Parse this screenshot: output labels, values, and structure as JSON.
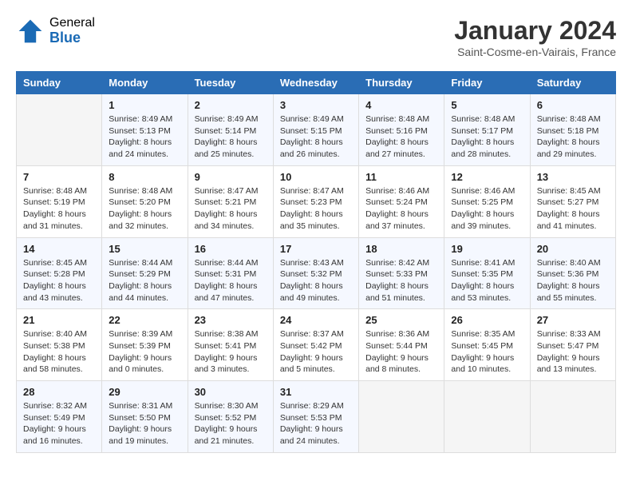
{
  "logo": {
    "general": "General",
    "blue": "Blue"
  },
  "title": "January 2024",
  "location": "Saint-Cosme-en-Vairais, France",
  "weekdays": [
    "Sunday",
    "Monday",
    "Tuesday",
    "Wednesday",
    "Thursday",
    "Friday",
    "Saturday"
  ],
  "weeks": [
    [
      {
        "day": "",
        "text": ""
      },
      {
        "day": "1",
        "text": "Sunrise: 8:49 AM\nSunset: 5:13 PM\nDaylight: 8 hours\nand 24 minutes."
      },
      {
        "day": "2",
        "text": "Sunrise: 8:49 AM\nSunset: 5:14 PM\nDaylight: 8 hours\nand 25 minutes."
      },
      {
        "day": "3",
        "text": "Sunrise: 8:49 AM\nSunset: 5:15 PM\nDaylight: 8 hours\nand 26 minutes."
      },
      {
        "day": "4",
        "text": "Sunrise: 8:48 AM\nSunset: 5:16 PM\nDaylight: 8 hours\nand 27 minutes."
      },
      {
        "day": "5",
        "text": "Sunrise: 8:48 AM\nSunset: 5:17 PM\nDaylight: 8 hours\nand 28 minutes."
      },
      {
        "day": "6",
        "text": "Sunrise: 8:48 AM\nSunset: 5:18 PM\nDaylight: 8 hours\nand 29 minutes."
      }
    ],
    [
      {
        "day": "7",
        "text": "Sunrise: 8:48 AM\nSunset: 5:19 PM\nDaylight: 8 hours\nand 31 minutes."
      },
      {
        "day": "8",
        "text": "Sunrise: 8:48 AM\nSunset: 5:20 PM\nDaylight: 8 hours\nand 32 minutes."
      },
      {
        "day": "9",
        "text": "Sunrise: 8:47 AM\nSunset: 5:21 PM\nDaylight: 8 hours\nand 34 minutes."
      },
      {
        "day": "10",
        "text": "Sunrise: 8:47 AM\nSunset: 5:23 PM\nDaylight: 8 hours\nand 35 minutes."
      },
      {
        "day": "11",
        "text": "Sunrise: 8:46 AM\nSunset: 5:24 PM\nDaylight: 8 hours\nand 37 minutes."
      },
      {
        "day": "12",
        "text": "Sunrise: 8:46 AM\nSunset: 5:25 PM\nDaylight: 8 hours\nand 39 minutes."
      },
      {
        "day": "13",
        "text": "Sunrise: 8:45 AM\nSunset: 5:27 PM\nDaylight: 8 hours\nand 41 minutes."
      }
    ],
    [
      {
        "day": "14",
        "text": "Sunrise: 8:45 AM\nSunset: 5:28 PM\nDaylight: 8 hours\nand 43 minutes."
      },
      {
        "day": "15",
        "text": "Sunrise: 8:44 AM\nSunset: 5:29 PM\nDaylight: 8 hours\nand 44 minutes."
      },
      {
        "day": "16",
        "text": "Sunrise: 8:44 AM\nSunset: 5:31 PM\nDaylight: 8 hours\nand 47 minutes."
      },
      {
        "day": "17",
        "text": "Sunrise: 8:43 AM\nSunset: 5:32 PM\nDaylight: 8 hours\nand 49 minutes."
      },
      {
        "day": "18",
        "text": "Sunrise: 8:42 AM\nSunset: 5:33 PM\nDaylight: 8 hours\nand 51 minutes."
      },
      {
        "day": "19",
        "text": "Sunrise: 8:41 AM\nSunset: 5:35 PM\nDaylight: 8 hours\nand 53 minutes."
      },
      {
        "day": "20",
        "text": "Sunrise: 8:40 AM\nSunset: 5:36 PM\nDaylight: 8 hours\nand 55 minutes."
      }
    ],
    [
      {
        "day": "21",
        "text": "Sunrise: 8:40 AM\nSunset: 5:38 PM\nDaylight: 8 hours\nand 58 minutes."
      },
      {
        "day": "22",
        "text": "Sunrise: 8:39 AM\nSunset: 5:39 PM\nDaylight: 9 hours\nand 0 minutes."
      },
      {
        "day": "23",
        "text": "Sunrise: 8:38 AM\nSunset: 5:41 PM\nDaylight: 9 hours\nand 3 minutes."
      },
      {
        "day": "24",
        "text": "Sunrise: 8:37 AM\nSunset: 5:42 PM\nDaylight: 9 hours\nand 5 minutes."
      },
      {
        "day": "25",
        "text": "Sunrise: 8:36 AM\nSunset: 5:44 PM\nDaylight: 9 hours\nand 8 minutes."
      },
      {
        "day": "26",
        "text": "Sunrise: 8:35 AM\nSunset: 5:45 PM\nDaylight: 9 hours\nand 10 minutes."
      },
      {
        "day": "27",
        "text": "Sunrise: 8:33 AM\nSunset: 5:47 PM\nDaylight: 9 hours\nand 13 minutes."
      }
    ],
    [
      {
        "day": "28",
        "text": "Sunrise: 8:32 AM\nSunset: 5:49 PM\nDaylight: 9 hours\nand 16 minutes."
      },
      {
        "day": "29",
        "text": "Sunrise: 8:31 AM\nSunset: 5:50 PM\nDaylight: 9 hours\nand 19 minutes."
      },
      {
        "day": "30",
        "text": "Sunrise: 8:30 AM\nSunset: 5:52 PM\nDaylight: 9 hours\nand 21 minutes."
      },
      {
        "day": "31",
        "text": "Sunrise: 8:29 AM\nSunset: 5:53 PM\nDaylight: 9 hours\nand 24 minutes."
      },
      {
        "day": "",
        "text": ""
      },
      {
        "day": "",
        "text": ""
      },
      {
        "day": "",
        "text": ""
      }
    ]
  ]
}
